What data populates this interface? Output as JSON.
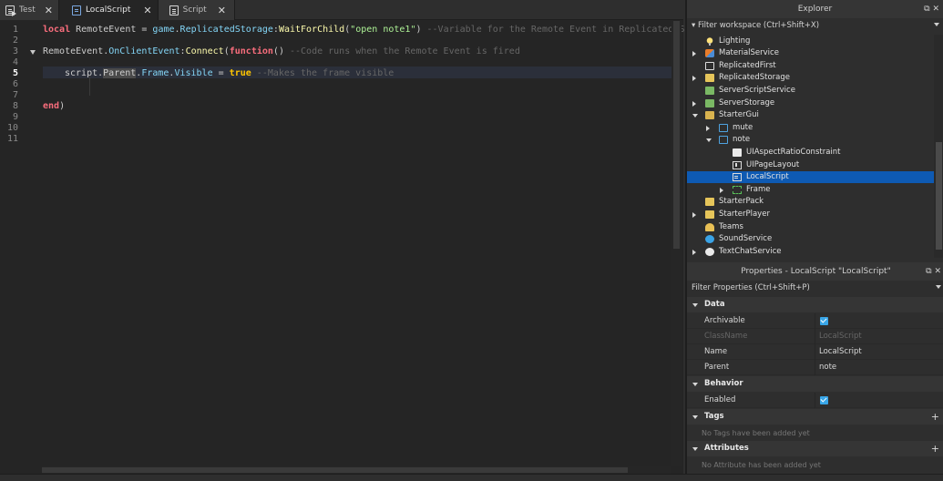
{
  "tabs": [
    {
      "label": "Test",
      "icon": "script-doc-icon",
      "active": false
    },
    {
      "label": "LocalScript",
      "icon": "localscript-icon",
      "active": true
    },
    {
      "label": "Script",
      "icon": "script-icon",
      "active": false
    }
  ],
  "tab_close": "✕",
  "editor": {
    "line_numbers": [
      "1",
      "2",
      "3",
      "4",
      "5",
      "6",
      "7",
      "8",
      "9",
      "10",
      "11"
    ],
    "current_line": "5",
    "code": {
      "l1_kw": "local",
      "l1_a": " RemoteEvent = ",
      "l1_game": "game",
      "l1_dot": ".",
      "l1_rs": "ReplicatedStorage",
      "l1_colon": ":",
      "l1_wfc": "WaitForChild",
      "l1_po": "(",
      "l1_str": "\"open note1\"",
      "l1_pc": ") ",
      "l1_cmt": "--Variable for the Remote Event in Replicated S",
      "l3_a": "RemoteEvent.",
      "l3_evt": "OnClientEvent",
      "l3_colon": ":",
      "l3_conn": "Connect",
      "l3_po": "(",
      "l3_fn": "function",
      "l3_pc": "() ",
      "l3_cmt": "--Code runs when the Remote Event is fired",
      "l5_script": "script",
      "l5_dot": ".",
      "l5_parent": "Parent",
      "l5_b": ".",
      "l5_frame": "Frame",
      "l5_c": ".",
      "l5_visible": "Visible",
      "l5_eq": " = ",
      "l5_true": "true",
      "l5_sp": " ",
      "l5_cmt": "--Makes the frame visible",
      "l8_end": "end",
      "l8_pc": ")"
    }
  },
  "explorer": {
    "title": "Explorer",
    "filter_placeholder": "Filter workspace (Ctrl+Shift+X)",
    "controls": "⧉ ✕",
    "items": [
      {
        "label": "Lighting",
        "icon": "lightbulb-icon",
        "arrow": ""
      },
      {
        "label": "MaterialService",
        "icon": "material-service-icon",
        "arrow": "right"
      },
      {
        "label": "ReplicatedFirst",
        "icon": "replicated-first-icon",
        "arrow": ""
      },
      {
        "label": "ReplicatedStorage",
        "icon": "replicated-storage-icon",
        "arrow": "right"
      },
      {
        "label": "ServerScriptService",
        "icon": "server-script-service-icon",
        "arrow": ""
      },
      {
        "label": "ServerStorage",
        "icon": "server-storage-icon",
        "arrow": "right"
      },
      {
        "label": "StarterGui",
        "icon": "starter-gui-icon",
        "arrow": "down"
      },
      {
        "label": "mute",
        "icon": "screen-gui-icon",
        "arrow": "right"
      },
      {
        "label": "note",
        "icon": "screen-gui-icon",
        "arrow": "down"
      },
      {
        "label": "UIAspectRatioConstraint",
        "icon": "aspect-ratio-icon",
        "arrow": ""
      },
      {
        "label": "UIPageLayout",
        "icon": "page-layout-icon",
        "arrow": ""
      },
      {
        "label": "LocalScript",
        "icon": "localscript-icon",
        "arrow": "",
        "selected": true
      },
      {
        "label": "Frame",
        "icon": "frame-icon",
        "arrow": "right"
      },
      {
        "label": "StarterPack",
        "icon": "starter-pack-icon",
        "arrow": ""
      },
      {
        "label": "StarterPlayer",
        "icon": "starter-player-icon",
        "arrow": "right"
      },
      {
        "label": "Teams",
        "icon": "teams-icon",
        "arrow": ""
      },
      {
        "label": "SoundService",
        "icon": "sound-service-icon",
        "arrow": ""
      },
      {
        "label": "TextChatService",
        "icon": "text-chat-service-icon",
        "arrow": "right"
      }
    ]
  },
  "properties": {
    "title": "Properties - LocalScript \"LocalScript\"",
    "filter_placeholder": "Filter Properties (Ctrl+Shift+P)",
    "controls": "⧉ ✕",
    "data_section": "Data",
    "archivable_label": "Archivable",
    "archivable_checked": true,
    "classname_label": "ClassName",
    "classname_value": "LocalScript",
    "name_label": "Name",
    "name_value": "LocalScript",
    "parent_label": "Parent",
    "parent_value": "note",
    "behavior_section": "Behavior",
    "enabled_label": "Enabled",
    "enabled_checked": true,
    "tags_section": "Tags",
    "tags_empty": "No Tags have been added yet",
    "attributes_section": "Attributes",
    "attributes_empty": "No Attribute has been added yet",
    "plus": "+"
  },
  "colors": {
    "keyword": "#f86d7c",
    "string": "#adf195",
    "comment": "#666666",
    "selection": "#0e5ab3",
    "checkbox": "#39a6e8"
  }
}
